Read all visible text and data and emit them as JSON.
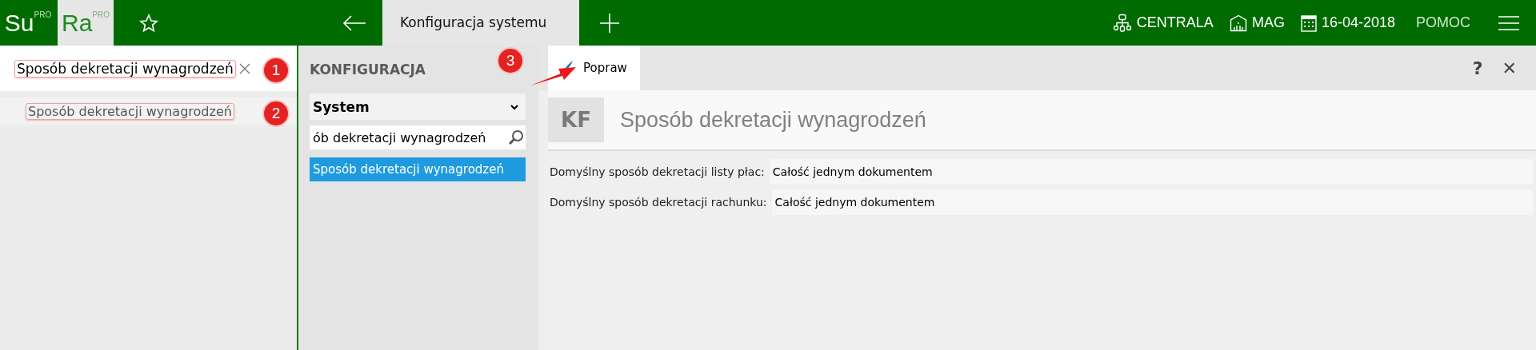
{
  "top_bar": {
    "apps": [
      {
        "label": "Su",
        "badge": "PRO",
        "selected": false
      },
      {
        "label": "Ra",
        "badge": "PRO",
        "selected": true
      }
    ],
    "tab": {
      "label": "Konfiguracja systemu"
    },
    "status": [
      {
        "kind": "branch",
        "label": "CENTRALA"
      },
      {
        "kind": "warehouse",
        "label": "MAG"
      },
      {
        "kind": "date",
        "label": "16-04-2018"
      },
      {
        "kind": "plain",
        "label": "POMOC"
      }
    ]
  },
  "left_panel": {
    "search": {
      "value": "Sposób dekretacji wynagrodzeń"
    },
    "results": [
      {
        "label": "Sposób dekretacji wynagrodzeń"
      }
    ]
  },
  "middle_panel": {
    "heading": "KONFIGURACJA",
    "select": {
      "value": "System"
    },
    "search": {
      "value": "ób dekretacji wynagrodzeń"
    },
    "items": [
      {
        "label": "Sposób dekretacji wynagrodzeń",
        "selected": true
      }
    ]
  },
  "detail": {
    "toolbar": {
      "action": "Popraw",
      "help": "?",
      "close": "✕"
    },
    "initials": "KF",
    "title": "Sposób dekretacji wynagrodzeń",
    "fields": [
      {
        "label": "Domyślny sposób dekretacji listy płac:",
        "value": "Całość jednym dokumentem"
      },
      {
        "label": "Domyślny sposób dekretacji rachunku:",
        "value": "Całość jednym dokumentem"
      }
    ]
  },
  "annotations": [
    "1",
    "2",
    "3"
  ]
}
